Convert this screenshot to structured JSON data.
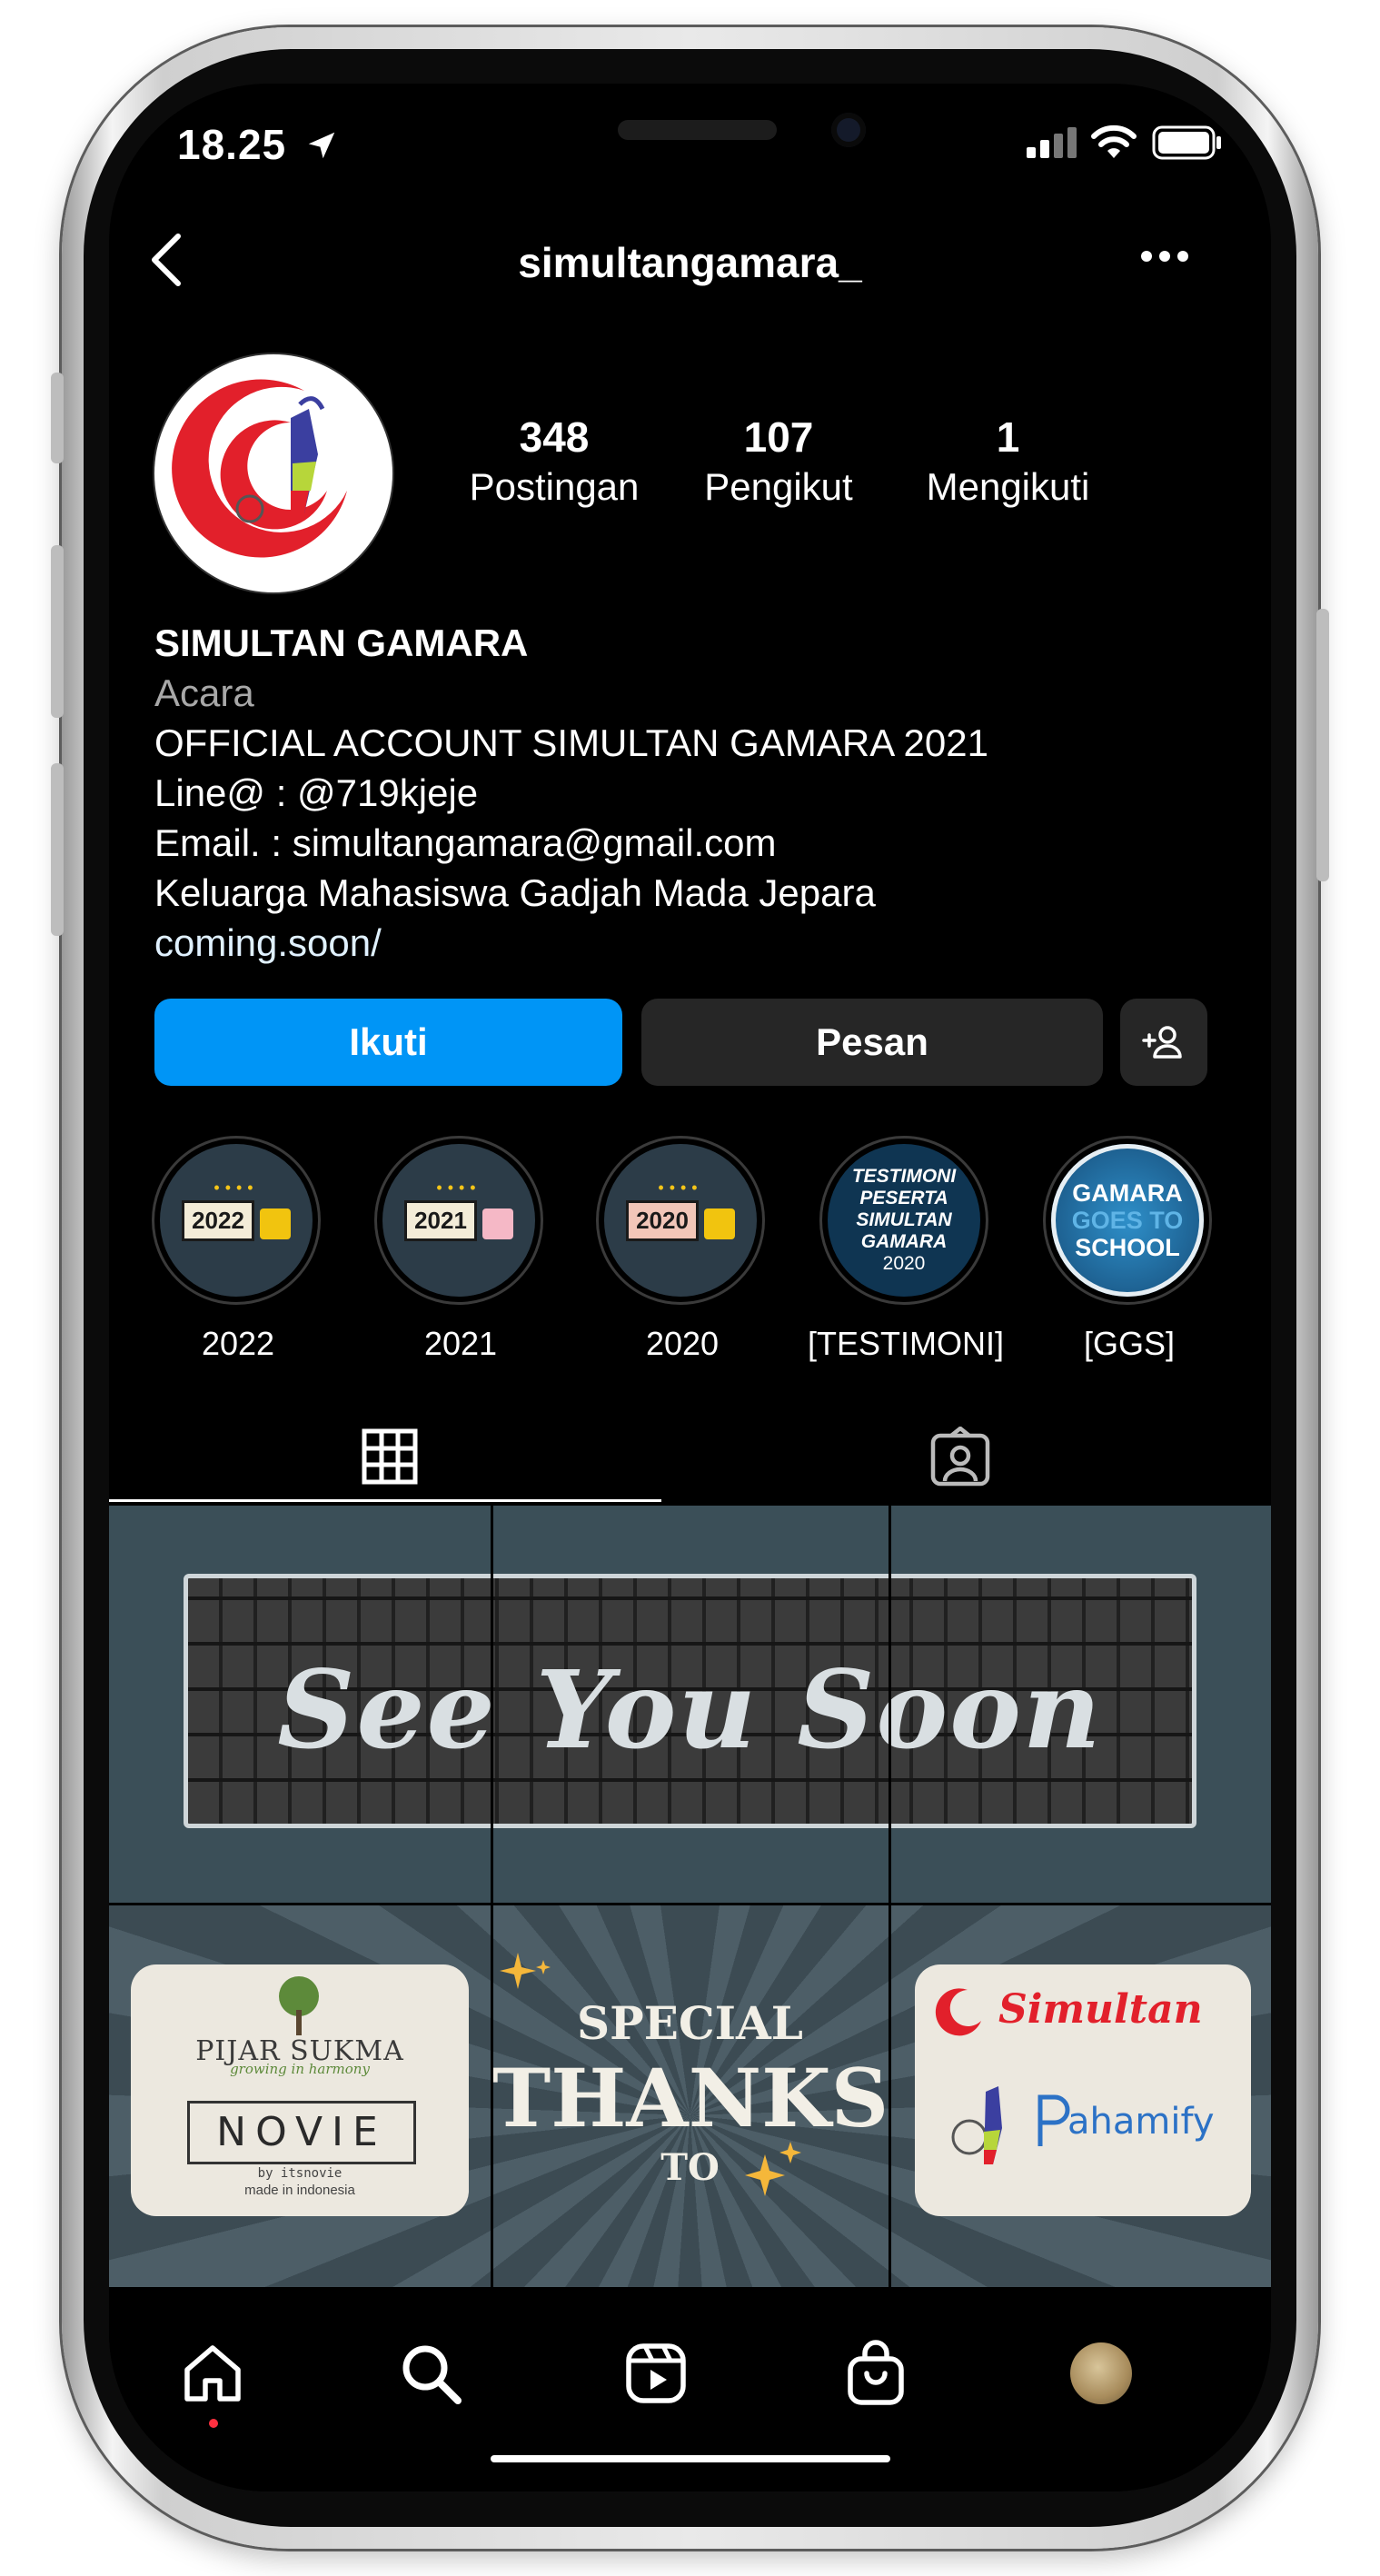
{
  "status_bar": {
    "time": "18.25"
  },
  "header": {
    "username": "simultangamara_"
  },
  "profile": {
    "stats": [
      {
        "value": "348",
        "label": "Postingan"
      },
      {
        "value": "107",
        "label": "Pengikut"
      },
      {
        "value": "1",
        "label": "Mengikuti"
      }
    ],
    "name": "SIMULTAN GAMARA",
    "category": "Acara",
    "bio_lines": [
      "OFFICIAL ACCOUNT SIMULTAN GAMARA 2021",
      "Line@ : @719kjeje",
      "Email. : simultangamara@gmail.com",
      "Keluarga Mahasiswa Gadjah Mada Jepara"
    ],
    "link": "coming.soon/"
  },
  "buttons": {
    "follow": "Ikuti",
    "message": "Pesan"
  },
  "highlights": [
    {
      "label": "2022",
      "tag": "2022"
    },
    {
      "label": "2021",
      "tag": "2021"
    },
    {
      "label": "2020",
      "tag": "2020"
    },
    {
      "label": "[TESTIMONI]",
      "lines": [
        "TESTIMONI",
        "PESERTA",
        "SIMULTAN",
        "GAMARA",
        "2020"
      ]
    },
    {
      "label": "[GGS]",
      "lines": [
        "GAMARA",
        "GOES TO",
        "SCHOOL"
      ]
    }
  ],
  "posts": {
    "post1_text": "See You Soon",
    "post2": {
      "pijar_title": "PIJAR SUKMA",
      "pijar_tagline": "growing in harmony",
      "novie": "NOVIE",
      "novie_by": "by itsnovie",
      "novie_made": "made in indonesia",
      "special": "SPECIAL",
      "thanks": "THANKS",
      "to": "TO",
      "simultan": "Simultan",
      "pahamify": "ahamify"
    }
  },
  "colors": {
    "accent": "#0095f6",
    "logo_red": "#e2202b"
  }
}
